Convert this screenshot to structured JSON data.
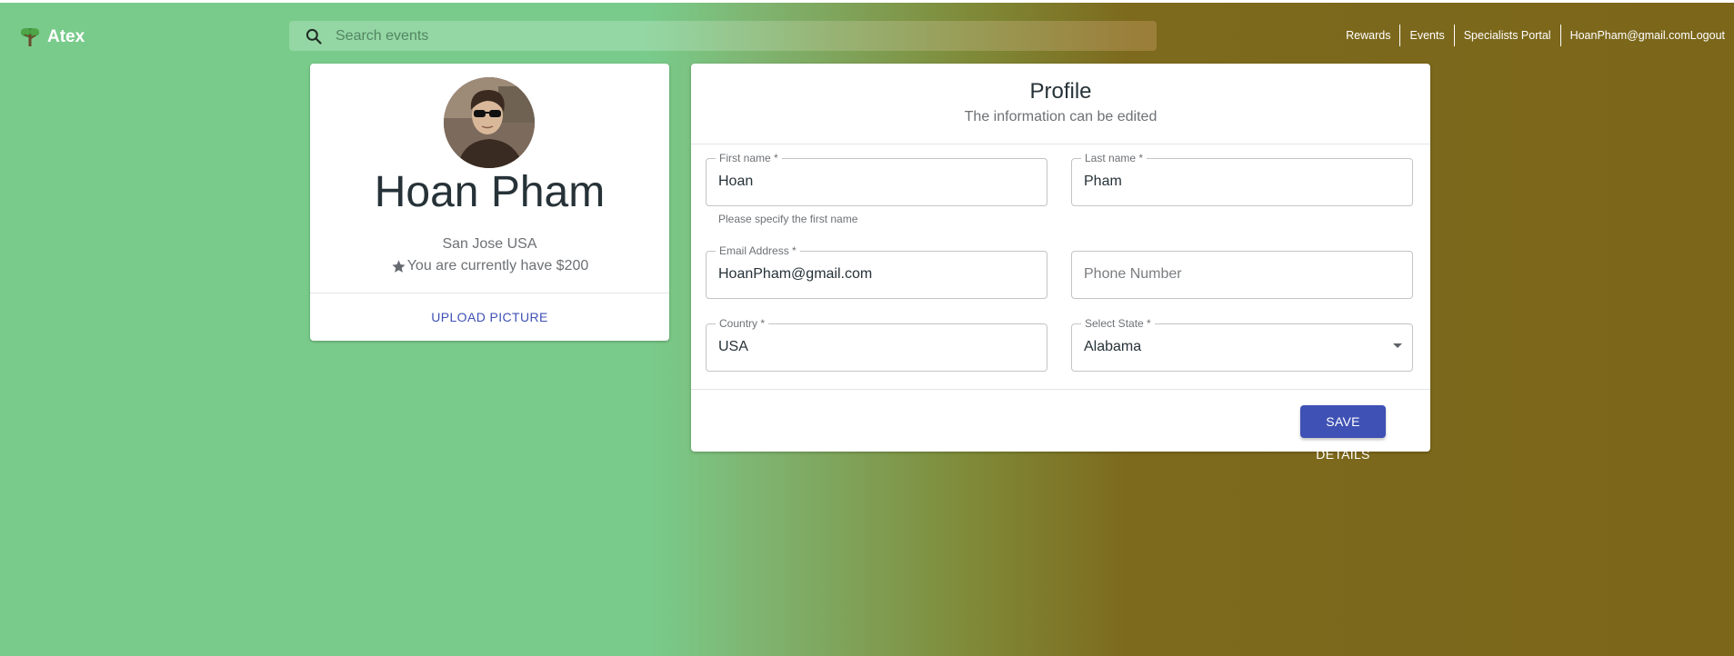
{
  "app": {
    "name": "Atex"
  },
  "search": {
    "placeholder": "Search events"
  },
  "nav": {
    "rewards": "Rewards",
    "events": "Events",
    "specialists_portal": "Specialists Portal",
    "email": "HoanPham@gmail.com",
    "logout": "Logout"
  },
  "user_card": {
    "name": "Hoan Pham",
    "location": "San Jose USA",
    "balance_text": "You are currently have $200",
    "upload_label": "UPLOAD PICTURE"
  },
  "profile": {
    "title": "Profile",
    "subtitle": "The information can be edited",
    "first_name": {
      "label": "First name *",
      "value": "Hoan",
      "helper": "Please specify the first name"
    },
    "last_name": {
      "label": "Last name *",
      "value": "Pham"
    },
    "email": {
      "label": "Email Address *",
      "value": "HoanPham@gmail.com"
    },
    "phone": {
      "placeholder": "Phone Number"
    },
    "country": {
      "label": "Country *",
      "value": "USA"
    },
    "state": {
      "label": "Select State *",
      "value": "Alabama"
    },
    "save_label": "SAVE DETAILS"
  },
  "colors": {
    "primary": "#3f51b5",
    "bg_green": "#79cb8b",
    "bg_olive": "#7b661a"
  },
  "icons": {
    "logo": "tree-icon",
    "search": "search-icon",
    "star": "star-icon",
    "dropdown": "chevron-down-icon"
  }
}
